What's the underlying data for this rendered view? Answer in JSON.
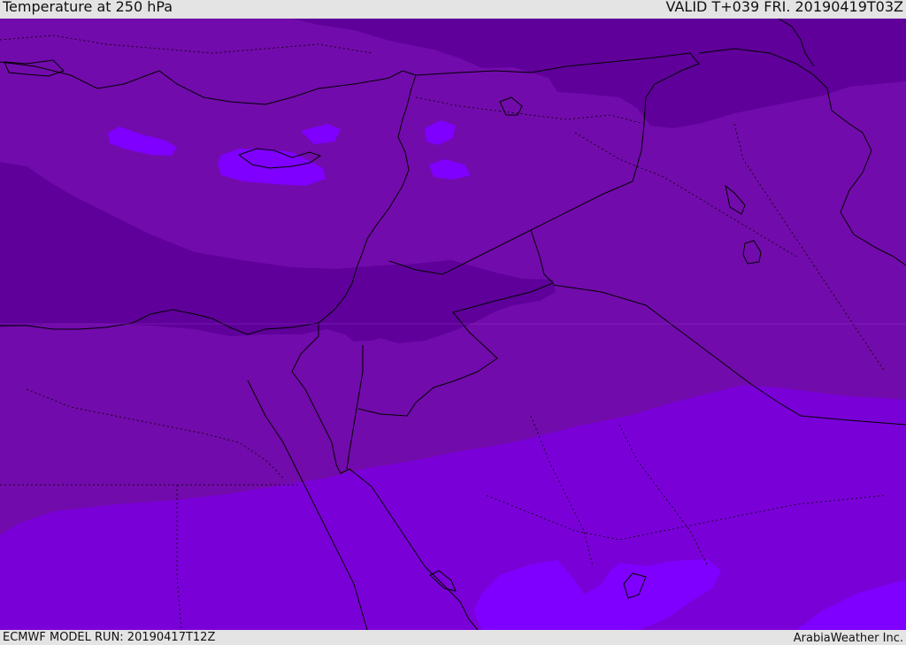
{
  "header": {
    "title": "Temperature at 250 hPa",
    "valid_time": "VALID T+039 FRI. 20190419T03Z"
  },
  "footer": {
    "model_run": "ECMWF MODEL RUN: 20190417T12Z",
    "credit": "ArabiaWeather Inc."
  },
  "map": {
    "variable": "temperature",
    "pressure_level_hpa": 250,
    "colors": {
      "coldest": "#5f009a",
      "cold": "#720bab",
      "mild": "#7a00d8",
      "warm": "#7f00ff",
      "boundary_line": "#000000"
    }
  }
}
